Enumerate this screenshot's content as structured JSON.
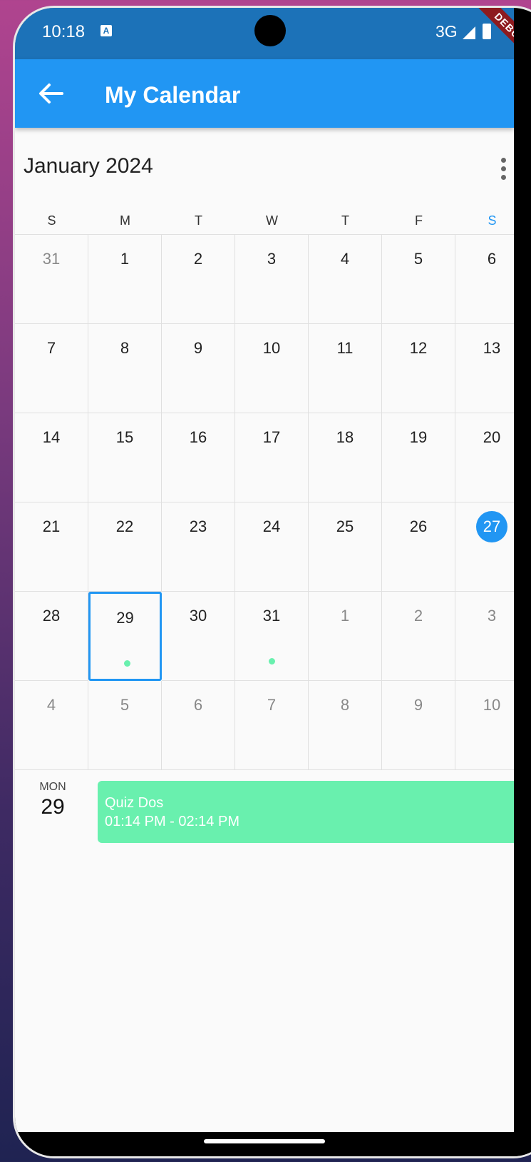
{
  "status_bar": {
    "time": "10:18",
    "network": "3G",
    "debug_label": "DEBUG"
  },
  "app_bar": {
    "title": "My Calendar"
  },
  "calendar": {
    "month_title": "January 2024",
    "weekdays": [
      "S",
      "M",
      "T",
      "W",
      "T",
      "F",
      "S"
    ],
    "weekday_colors": [
      "#333333",
      "#333333",
      "#333333",
      "#333333",
      "#333333",
      "#333333",
      "#2196f3"
    ],
    "weeks": [
      [
        "31",
        "1",
        "2",
        "3",
        "4",
        "5",
        "6"
      ],
      [
        "7",
        "8",
        "9",
        "10",
        "11",
        "12",
        "13"
      ],
      [
        "14",
        "15",
        "16",
        "17",
        "18",
        "19",
        "20"
      ],
      [
        "21",
        "22",
        "23",
        "24",
        "25",
        "26",
        "27"
      ],
      [
        "28",
        "29",
        "30",
        "31",
        "1",
        "2",
        "3"
      ],
      [
        "4",
        "5",
        "6",
        "7",
        "8",
        "9",
        "10"
      ]
    ],
    "today": "27",
    "selected": "29",
    "event_dot_days": [
      "29",
      "31"
    ],
    "accent_color": "#2196f3",
    "event_color": "#69f0ae"
  },
  "agenda": {
    "weekday": "MON",
    "date": "29",
    "events": [
      {
        "title": "Quiz Dos",
        "time": "01:14 PM - 02:14 PM"
      }
    ]
  }
}
